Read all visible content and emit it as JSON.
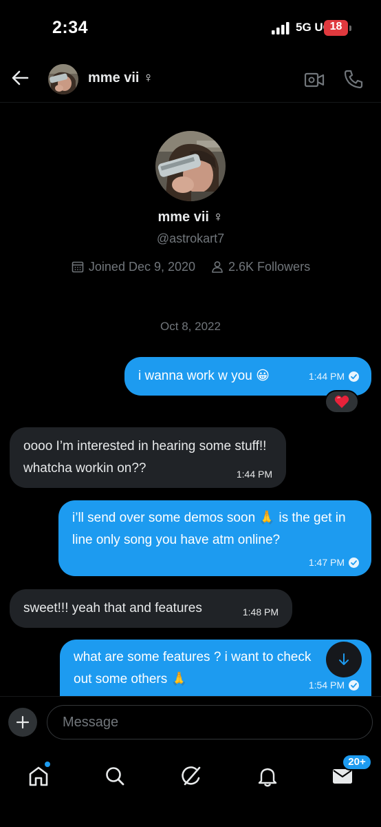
{
  "status_bar": {
    "time": "2:34",
    "network": "5G UC",
    "battery_level": "18"
  },
  "header": {
    "contact_name": "mme vii ♀"
  },
  "profile": {
    "name": "mme vii ♀",
    "handle": "@astrokart7",
    "joined": "Joined Dec 9, 2020",
    "followers": "2.6K Followers"
  },
  "conversation": {
    "date_separator": "Oct 8, 2022",
    "messages": [
      {
        "direction": "sent",
        "text": "i wanna work w you 😀",
        "time": "1:44 PM",
        "seen": true,
        "reaction": "❤️"
      },
      {
        "direction": "received",
        "text": "oooo I’m interested in hearing some stuff!! whatcha workin on??",
        "time": "1:44 PM"
      },
      {
        "direction": "sent",
        "text": "i’ll send over some demos soon 🙏 is the get in line only song you have atm online?",
        "time": "1:47 PM",
        "seen": true
      },
      {
        "direction": "received",
        "text": "sweet!!! yeah that and features",
        "time": "1:48 PM"
      },
      {
        "direction": "sent",
        "text": "what are some features ? i want to check out some others 🙏",
        "time": "1:54 PM",
        "seen": true
      }
    ]
  },
  "composer": {
    "placeholder": "Message"
  },
  "bottom_nav": {
    "items": [
      "home-icon",
      "search-icon",
      "grok-icon",
      "notifications-icon",
      "messages-icon"
    ],
    "messages_badge": "20+"
  },
  "colors": {
    "accent": "#1d9bf0",
    "received_bubble": "#202327",
    "background": "#000000",
    "muted_text": "#71767b",
    "battery": "#e0393e"
  }
}
